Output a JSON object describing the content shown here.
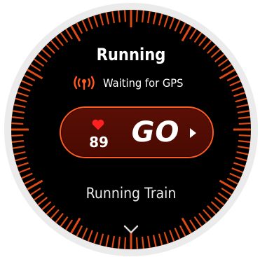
{
  "workout": {
    "title": "Running",
    "gps_status": "Waiting for GPS",
    "heart_rate": "89",
    "go_label": "GO",
    "mode_label": "Running Train"
  },
  "icons": {
    "gps": "gps-signal-icon",
    "heart": "heart-icon",
    "go_arrow": "play-arrow-icon",
    "more": "chevron-down-icon"
  },
  "colors": {
    "accent": "#ff5a1f",
    "tick": "#e04a14",
    "heart": "#ff2020",
    "pill_bg": "#4f0c03",
    "face_bg": "#000000",
    "bezel": "#ebebeb"
  }
}
